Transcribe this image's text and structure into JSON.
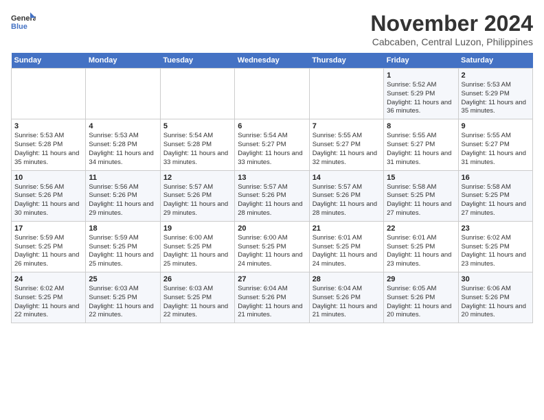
{
  "header": {
    "logo_line1": "General",
    "logo_line2": "Blue",
    "title": "November 2024",
    "subtitle": "Cabcaben, Central Luzon, Philippines"
  },
  "weekdays": [
    "Sunday",
    "Monday",
    "Tuesday",
    "Wednesday",
    "Thursday",
    "Friday",
    "Saturday"
  ],
  "weeks": [
    [
      {
        "day": "",
        "info": ""
      },
      {
        "day": "",
        "info": ""
      },
      {
        "day": "",
        "info": ""
      },
      {
        "day": "",
        "info": ""
      },
      {
        "day": "",
        "info": ""
      },
      {
        "day": "1",
        "info": "Sunrise: 5:52 AM\nSunset: 5:29 PM\nDaylight: 11 hours and 36 minutes."
      },
      {
        "day": "2",
        "info": "Sunrise: 5:53 AM\nSunset: 5:29 PM\nDaylight: 11 hours and 35 minutes."
      }
    ],
    [
      {
        "day": "3",
        "info": "Sunrise: 5:53 AM\nSunset: 5:28 PM\nDaylight: 11 hours and 35 minutes."
      },
      {
        "day": "4",
        "info": "Sunrise: 5:53 AM\nSunset: 5:28 PM\nDaylight: 11 hours and 34 minutes."
      },
      {
        "day": "5",
        "info": "Sunrise: 5:54 AM\nSunset: 5:28 PM\nDaylight: 11 hours and 33 minutes."
      },
      {
        "day": "6",
        "info": "Sunrise: 5:54 AM\nSunset: 5:27 PM\nDaylight: 11 hours and 33 minutes."
      },
      {
        "day": "7",
        "info": "Sunrise: 5:55 AM\nSunset: 5:27 PM\nDaylight: 11 hours and 32 minutes."
      },
      {
        "day": "8",
        "info": "Sunrise: 5:55 AM\nSunset: 5:27 PM\nDaylight: 11 hours and 31 minutes."
      },
      {
        "day": "9",
        "info": "Sunrise: 5:55 AM\nSunset: 5:27 PM\nDaylight: 11 hours and 31 minutes."
      }
    ],
    [
      {
        "day": "10",
        "info": "Sunrise: 5:56 AM\nSunset: 5:26 PM\nDaylight: 11 hours and 30 minutes."
      },
      {
        "day": "11",
        "info": "Sunrise: 5:56 AM\nSunset: 5:26 PM\nDaylight: 11 hours and 29 minutes."
      },
      {
        "day": "12",
        "info": "Sunrise: 5:57 AM\nSunset: 5:26 PM\nDaylight: 11 hours and 29 minutes."
      },
      {
        "day": "13",
        "info": "Sunrise: 5:57 AM\nSunset: 5:26 PM\nDaylight: 11 hours and 28 minutes."
      },
      {
        "day": "14",
        "info": "Sunrise: 5:57 AM\nSunset: 5:26 PM\nDaylight: 11 hours and 28 minutes."
      },
      {
        "day": "15",
        "info": "Sunrise: 5:58 AM\nSunset: 5:25 PM\nDaylight: 11 hours and 27 minutes."
      },
      {
        "day": "16",
        "info": "Sunrise: 5:58 AM\nSunset: 5:25 PM\nDaylight: 11 hours and 27 minutes."
      }
    ],
    [
      {
        "day": "17",
        "info": "Sunrise: 5:59 AM\nSunset: 5:25 PM\nDaylight: 11 hours and 26 minutes."
      },
      {
        "day": "18",
        "info": "Sunrise: 5:59 AM\nSunset: 5:25 PM\nDaylight: 11 hours and 25 minutes."
      },
      {
        "day": "19",
        "info": "Sunrise: 6:00 AM\nSunset: 5:25 PM\nDaylight: 11 hours and 25 minutes."
      },
      {
        "day": "20",
        "info": "Sunrise: 6:00 AM\nSunset: 5:25 PM\nDaylight: 11 hours and 24 minutes."
      },
      {
        "day": "21",
        "info": "Sunrise: 6:01 AM\nSunset: 5:25 PM\nDaylight: 11 hours and 24 minutes."
      },
      {
        "day": "22",
        "info": "Sunrise: 6:01 AM\nSunset: 5:25 PM\nDaylight: 11 hours and 23 minutes."
      },
      {
        "day": "23",
        "info": "Sunrise: 6:02 AM\nSunset: 5:25 PM\nDaylight: 11 hours and 23 minutes."
      }
    ],
    [
      {
        "day": "24",
        "info": "Sunrise: 6:02 AM\nSunset: 5:25 PM\nDaylight: 11 hours and 22 minutes."
      },
      {
        "day": "25",
        "info": "Sunrise: 6:03 AM\nSunset: 5:25 PM\nDaylight: 11 hours and 22 minutes."
      },
      {
        "day": "26",
        "info": "Sunrise: 6:03 AM\nSunset: 5:25 PM\nDaylight: 11 hours and 22 minutes."
      },
      {
        "day": "27",
        "info": "Sunrise: 6:04 AM\nSunset: 5:26 PM\nDaylight: 11 hours and 21 minutes."
      },
      {
        "day": "28",
        "info": "Sunrise: 6:04 AM\nSunset: 5:26 PM\nDaylight: 11 hours and 21 minutes."
      },
      {
        "day": "29",
        "info": "Sunrise: 6:05 AM\nSunset: 5:26 PM\nDaylight: 11 hours and 20 minutes."
      },
      {
        "day": "30",
        "info": "Sunrise: 6:06 AM\nSunset: 5:26 PM\nDaylight: 11 hours and 20 minutes."
      }
    ]
  ]
}
